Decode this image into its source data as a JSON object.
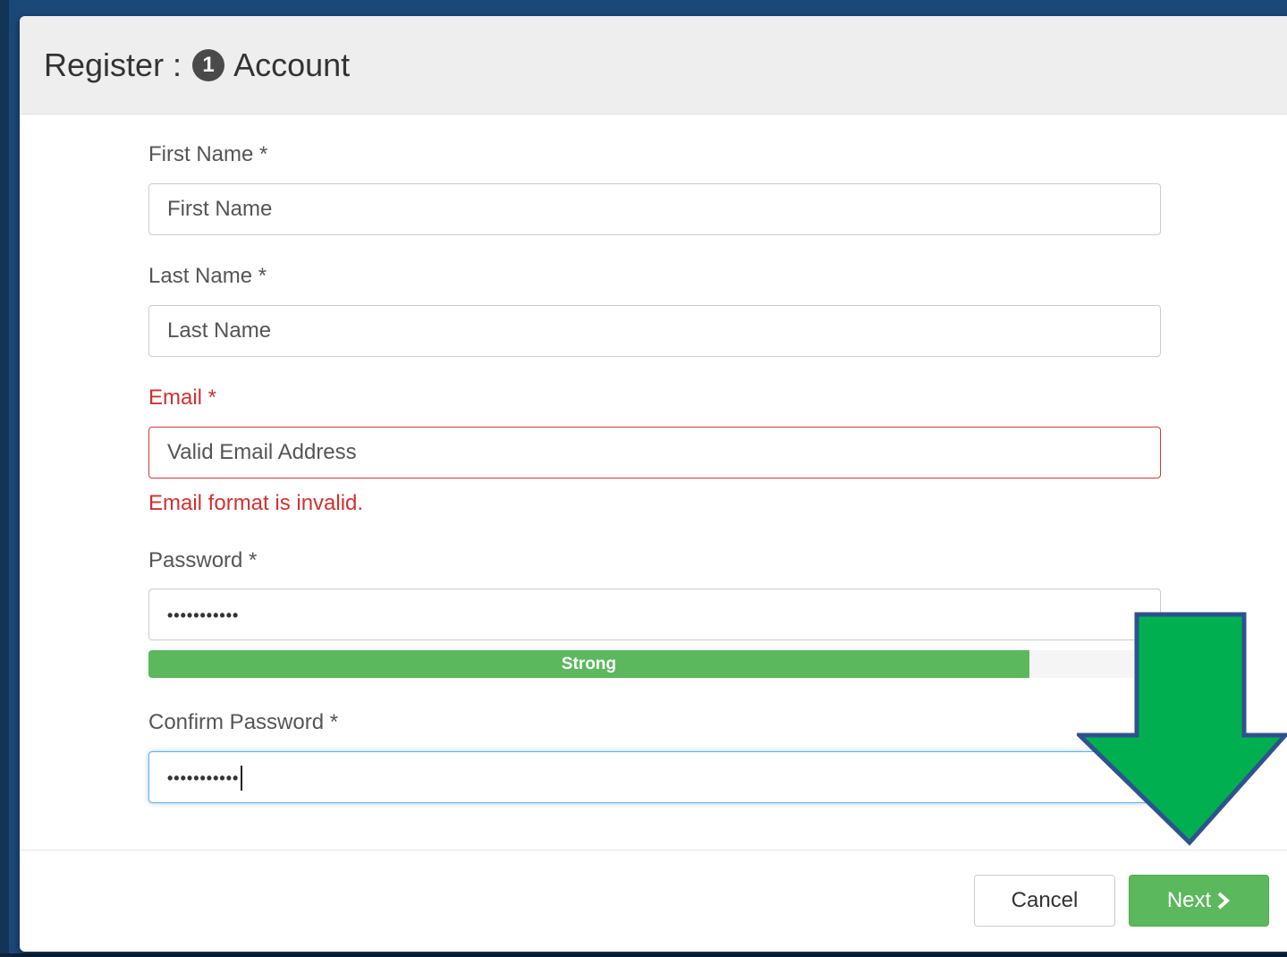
{
  "modal": {
    "title_prefix": "Register :",
    "step_number": "1",
    "title_step": "Account"
  },
  "form": {
    "first_name": {
      "label": "First Name *",
      "placeholder": "First Name"
    },
    "last_name": {
      "label": "Last Name *",
      "placeholder": "Last Name"
    },
    "email": {
      "label": "Email *",
      "placeholder": "Valid Email Address",
      "error": "Email format is invalid."
    },
    "password": {
      "label": "Password *",
      "value_masked": "•••••••••••"
    },
    "password_strength": {
      "label": "Strong",
      "level_percent": 87
    },
    "confirm_password": {
      "label": "Confirm Password *",
      "value_masked": "•••••••••••"
    }
  },
  "footer": {
    "cancel_label": "Cancel",
    "next_label": "Next"
  },
  "colors": {
    "backdrop": "#1c4878",
    "error": "#d03030",
    "success": "#5cb85c",
    "focus": "#66afe9",
    "arrow_fill": "#00b050",
    "arrow_stroke": "#2f528f"
  },
  "icons": {
    "next_icon": "chevron-right-icon",
    "annotation": "down-arrow-icon"
  }
}
